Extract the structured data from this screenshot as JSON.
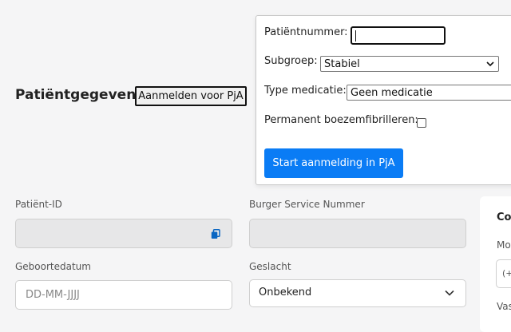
{
  "header": {
    "title": "Patiëntgegevens",
    "pja_button_label": "Aanmelden voor PjA"
  },
  "popover": {
    "patient_number_label": "Patiëntnummer:",
    "patient_number_value": "",
    "subgroup_label": "Subgroep:",
    "subgroup_value": "Stabiel",
    "medication_label": "Type medicatie:",
    "medication_value": "Geen medicatie",
    "af_label": "Permanent boezemfibrilleren:",
    "af_checked": false,
    "start_button_label": "Start aanmelding in PjA"
  },
  "form": {
    "patient_id_label": "Patiënt-ID",
    "patient_id_value": "",
    "bsn_label": "Burger Service Nummer",
    "bsn_value": "",
    "dob_label": "Geboortedatum",
    "dob_placeholder": "DD-MM-JJJJ",
    "gender_label": "Geslacht",
    "gender_value": "Onbekend"
  },
  "contact_card": {
    "title_partial": "Co",
    "label1_partial": "Mo",
    "input_partial": "(+",
    "label2_partial": "Vas"
  },
  "colors": {
    "primary": "#0a7cf5",
    "background": "#f5f5f6",
    "readonly_field": "#e7e7e8"
  }
}
